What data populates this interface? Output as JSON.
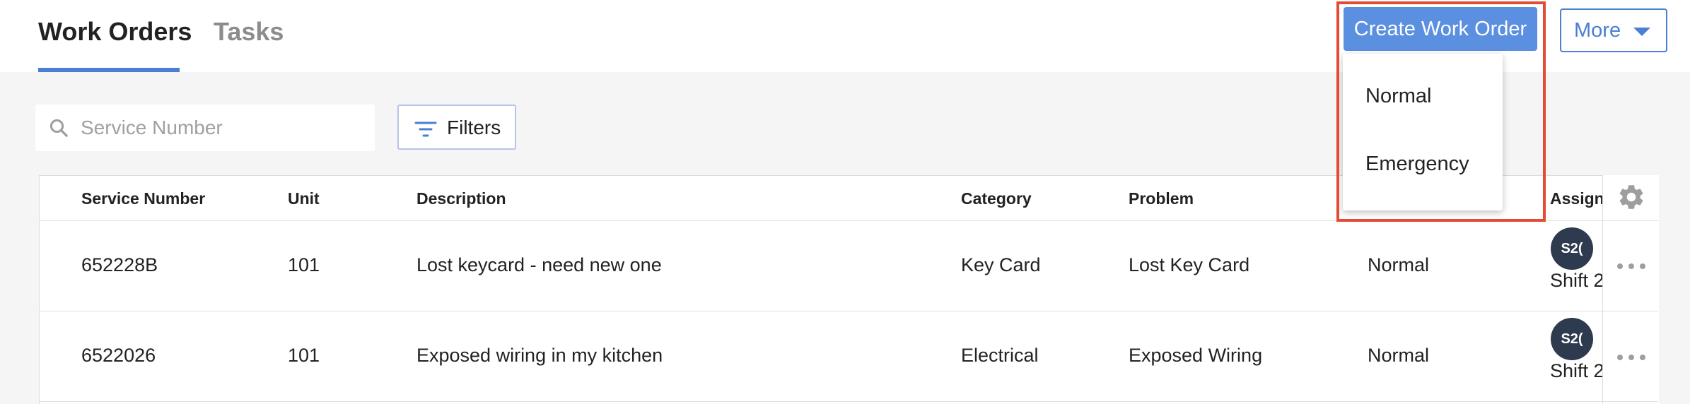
{
  "tabs": [
    {
      "label": "Work Orders",
      "active": true
    },
    {
      "label": "Tasks",
      "active": false
    }
  ],
  "actions": {
    "create_label": "Create Work Order",
    "more_label": "More"
  },
  "create_menu": {
    "options": [
      "Normal",
      "Emergency"
    ]
  },
  "search": {
    "placeholder": "Service Number",
    "value": ""
  },
  "filters": {
    "label": "Filters"
  },
  "table": {
    "columns": [
      "Service Number",
      "Unit",
      "Description",
      "Category",
      "Problem",
      "Assign"
    ],
    "rows": [
      {
        "service_number": "652228B",
        "unit": "101",
        "description": "Lost keycard - need new one",
        "category": "Key Card",
        "problem": "Lost Key Card",
        "priority": "Normal",
        "assignee_initials": "S2(",
        "assignee_name": "Shift 2"
      },
      {
        "service_number": "6522026",
        "unit": "101",
        "description": "Exposed wiring in my kitchen",
        "category": "Electrical",
        "problem": "Exposed Wiring",
        "priority": "Normal",
        "assignee_initials": "S2(",
        "assignee_name": "Shift 2"
      }
    ]
  },
  "colors": {
    "accent": "#5b8fe0",
    "highlight": "#e44b35",
    "avatar": "#2e3b4e"
  }
}
